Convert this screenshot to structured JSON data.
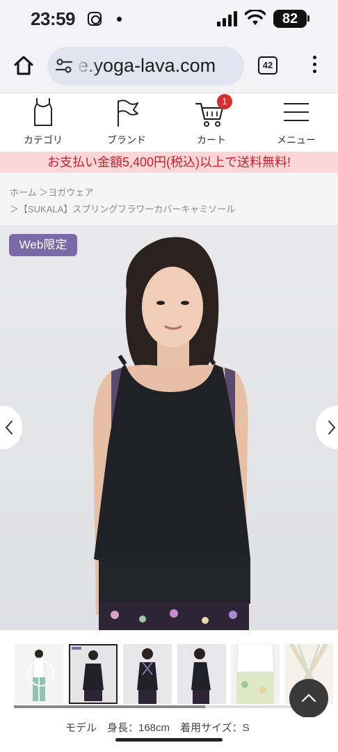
{
  "status_bar": {
    "time": "23:59",
    "battery": "82",
    "icons": [
      "instagram-icon",
      "notification-dot-icon",
      "cellular-signal-icon",
      "wifi-icon",
      "battery-icon"
    ]
  },
  "browser": {
    "url": "e.yoga-lava.com",
    "tab_count": "42",
    "icons": [
      "home-icon",
      "site-settings-icon",
      "tabs-icon",
      "more-vertical-icon"
    ]
  },
  "site_nav": {
    "items": [
      {
        "label": "カテゴリ",
        "icon": "tank-top-icon"
      },
      {
        "label": "ブランド",
        "icon": "flag-icon"
      },
      {
        "label": "カート",
        "icon": "cart-icon",
        "badge": "1"
      },
      {
        "label": "メニュー",
        "icon": "hamburger-menu-icon"
      }
    ]
  },
  "promo": {
    "text": "お支払い金額5,400円(税込)以上で送料無料!"
  },
  "breadcrumb": {
    "line1": "ホーム ＞ヨガウェア",
    "line2": "＞【SUKALA】スプリングフラワーカバーキャミソール"
  },
  "product": {
    "web_badge": "Web限定",
    "thumb_badge": "Web限定",
    "caption": "モデル　身長：168cm　着用サイズ：S"
  },
  "colors": {
    "badge": "#7b68a6",
    "promo_bg": "#fbd6d6",
    "promo_text": "#c8202f",
    "cart_badge": "#d32f2f"
  }
}
